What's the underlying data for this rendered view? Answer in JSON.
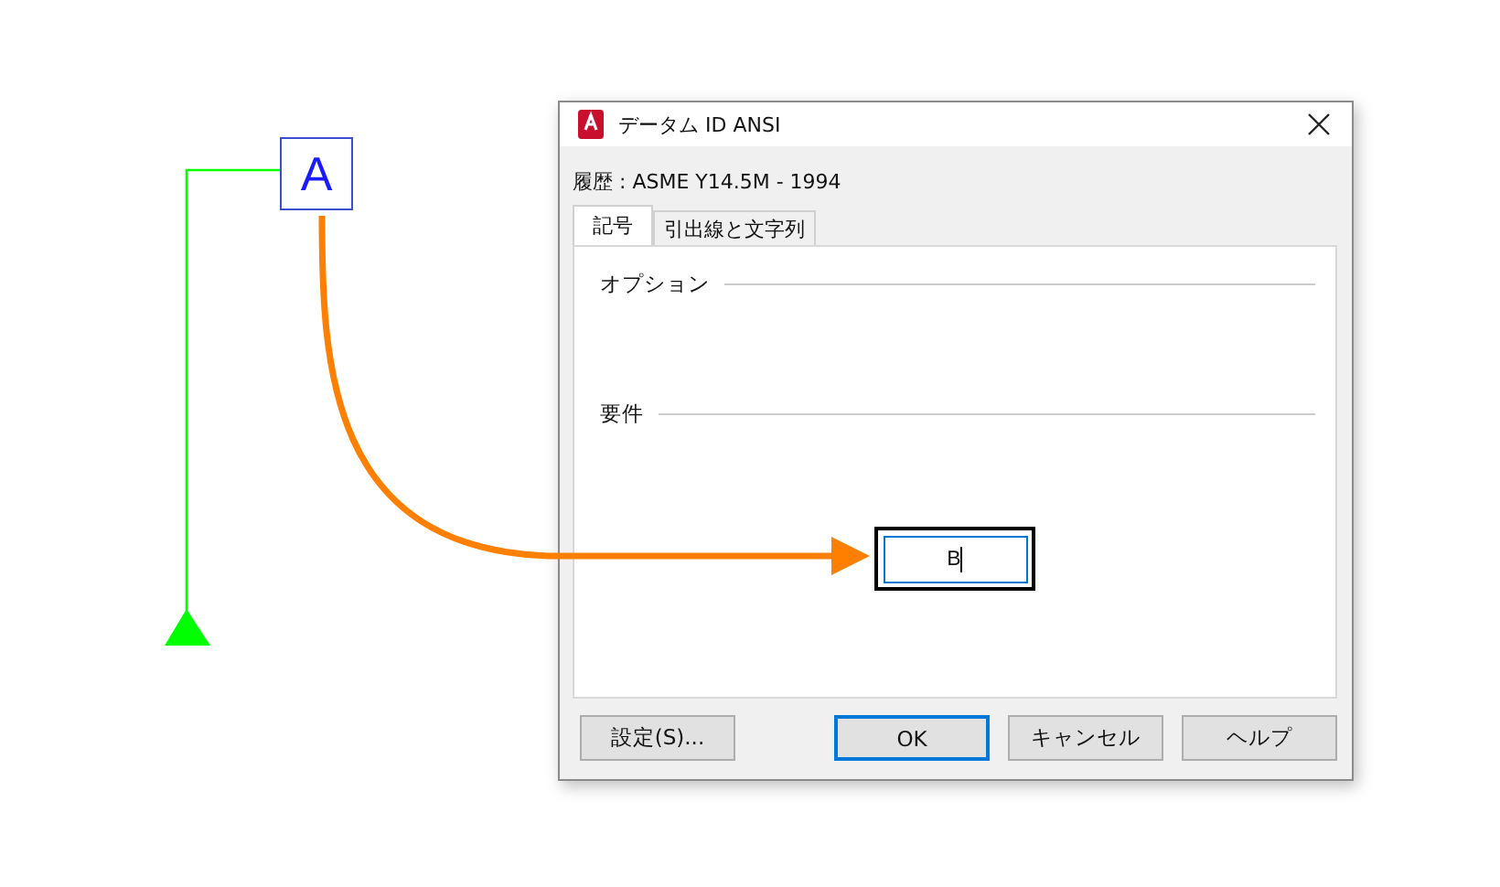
{
  "canvas": {
    "datum_label": "A"
  },
  "dialog": {
    "title": "データム ID ANSI",
    "history": "履歴 : ASME Y14.5M - 1994",
    "tabs": [
      {
        "label": "記号",
        "selected": true
      },
      {
        "label": "引出線と文字列",
        "selected": false
      }
    ],
    "sections": [
      {
        "label": "オプション"
      },
      {
        "label": "要件"
      }
    ],
    "field": {
      "value": "B",
      "focused": true
    },
    "buttons": [
      {
        "label": "設定(S)...",
        "default": false
      },
      {
        "label": "OK",
        "default": true
      },
      {
        "label": "キャンセル",
        "default": false
      },
      {
        "label": "ヘルプ",
        "default": false
      }
    ]
  }
}
